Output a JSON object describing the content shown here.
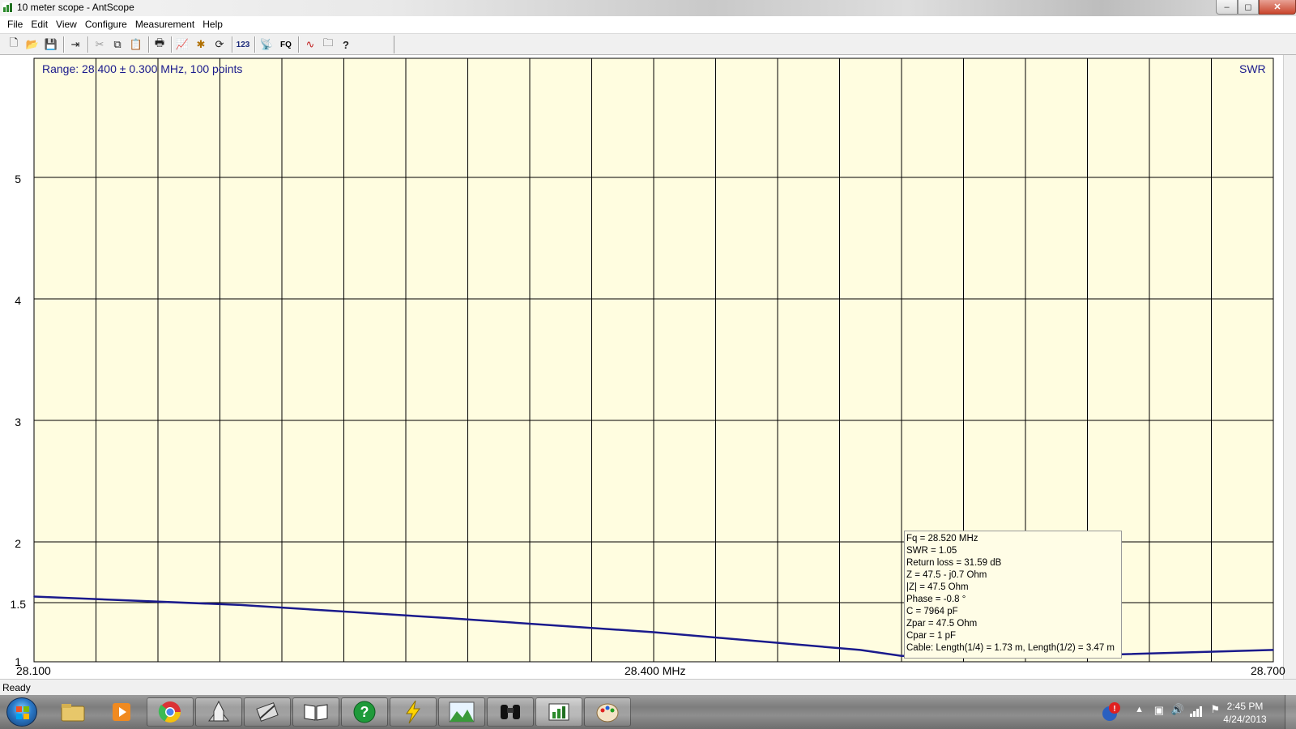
{
  "window": {
    "title": "10 meter scope - AntScope",
    "buttons": {
      "minimize": "–",
      "maximize": "◻",
      "close": "✕"
    }
  },
  "menu": [
    "File",
    "Edit",
    "View",
    "Configure",
    "Measurement",
    "Help"
  ],
  "toolbar": {
    "buttons": [
      {
        "name": "new-file-icon",
        "glyph": "🗋"
      },
      {
        "name": "open-folder-icon",
        "glyph": "📂"
      },
      {
        "name": "save-icon",
        "glyph": "💾"
      },
      {
        "name": "export-icon",
        "glyph": "⇥"
      },
      {
        "name": "cut-icon",
        "glyph": "✂"
      },
      {
        "name": "copy-icon",
        "glyph": "⧉"
      },
      {
        "name": "paste-icon",
        "glyph": "📋"
      },
      {
        "name": "print-icon",
        "glyph": "🖶"
      },
      {
        "name": "graph-icon",
        "glyph": "📈"
      },
      {
        "name": "star-icon",
        "glyph": "✱"
      },
      {
        "name": "refresh-icon",
        "glyph": "⟳"
      },
      {
        "name": "number-icon",
        "glyph": "123"
      },
      {
        "name": "antenna-icon",
        "glyph": "📡"
      },
      {
        "name": "fq-icon",
        "glyph": "FQ"
      },
      {
        "name": "wave-icon",
        "glyph": "∿"
      },
      {
        "name": "folder-list-icon",
        "glyph": "🗀"
      },
      {
        "name": "help-icon",
        "glyph": "?"
      }
    ]
  },
  "plot": {
    "range_text": "Range: 28.400 ± 0.300 MHz, 100 points",
    "parameter": "SWR",
    "background_color": "#fffde0",
    "grid_color": "#000000",
    "trace_color": "#1a1a8c",
    "y_ticks": [
      "5",
      "4",
      "3",
      "2",
      "1.5",
      "1"
    ],
    "x_ticks": {
      "left": "28.100",
      "center": "28.400 MHz",
      "right": "28.700"
    }
  },
  "readout": [
    "Fq = 28.520 MHz",
    "SWR = 1.05",
    "Return loss = 31.59 dB",
    "Z = 47.5 - j0.7 Ohm",
    "|Z| = 47.5 Ohm",
    "Phase = -0.8 °",
    "C = 7964 pF",
    "Zpar = 47.5 Ohm",
    "Cpar = 1 pF",
    "Cable: Length(1/4) = 1.73 m, Length(1/2) = 3.47 m"
  ],
  "chart_data": {
    "type": "line",
    "ylabel": "SWR",
    "x": [
      28.1,
      28.2,
      28.3,
      28.4,
      28.5,
      28.52,
      28.6,
      28.7
    ],
    "values": [
      1.55,
      1.48,
      1.37,
      1.25,
      1.1,
      1.05,
      1.05,
      1.1
    ],
    "xlim": [
      28.1,
      28.7
    ],
    "grid": true
  },
  "status": "Ready",
  "taskbar": {
    "apps": [
      {
        "name": "explorer-taskbar-icon"
      },
      {
        "name": "media-player-taskbar-icon"
      },
      {
        "name": "chrome-taskbar-icon"
      },
      {
        "name": "shuttle-taskbar-icon"
      },
      {
        "name": "tools-taskbar-icon"
      },
      {
        "name": "book-taskbar-icon"
      },
      {
        "name": "help-taskbar-icon"
      },
      {
        "name": "lightning-taskbar-icon"
      },
      {
        "name": "landscape-taskbar-icon"
      },
      {
        "name": "binoculars-taskbar-icon"
      },
      {
        "name": "antscope-taskbar-icon"
      },
      {
        "name": "paint-taskbar-icon"
      }
    ],
    "time": "2:45 PM",
    "date": "4/24/2013"
  }
}
